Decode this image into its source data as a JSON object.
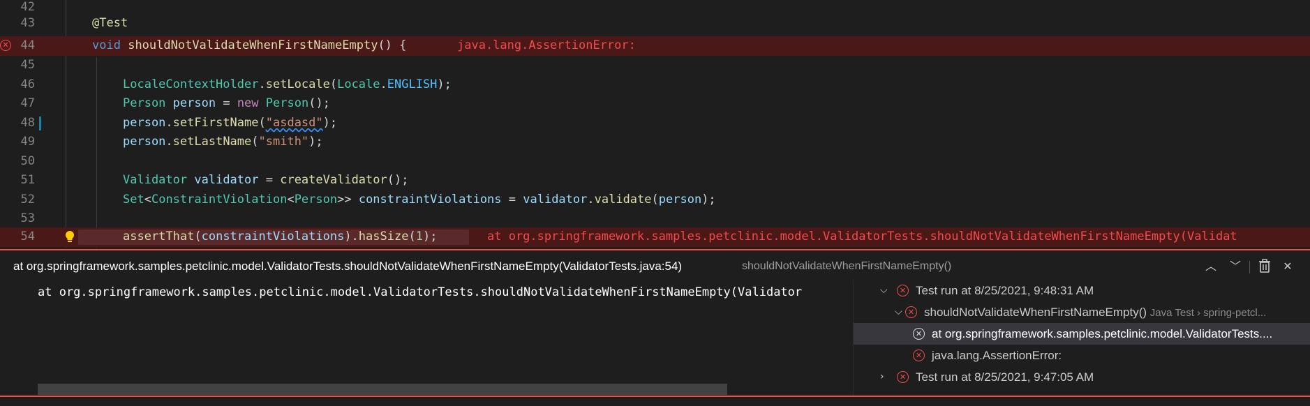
{
  "editor": {
    "lines": [
      {
        "num": "42"
      },
      {
        "num": "43",
        "annotation": "@Test"
      },
      {
        "num": "44",
        "kw": "void",
        "method": "shouldNotValidateWhenFirstNameEmpty",
        "rest": "() {",
        "inline_error": "java.lang.AssertionError:"
      },
      {
        "num": "45"
      },
      {
        "num": "46",
        "t1": "LocaleContextHolder",
        "m1": "setLocale",
        "t2": "Locale",
        "c1": "ENGLISH"
      },
      {
        "num": "47",
        "t1": "Person",
        "v1": "person",
        "kw": "new",
        "t2": "Person"
      },
      {
        "num": "48",
        "v1": "person",
        "m1": "setFirstName",
        "s1": "\"asdasd\""
      },
      {
        "num": "49",
        "v1": "person",
        "m1": "setLastName",
        "s1": "\"smith\""
      },
      {
        "num": "50"
      },
      {
        "num": "51",
        "t1": "Validator",
        "v1": "validator",
        "m1": "createValidator"
      },
      {
        "num": "52",
        "t1": "Set",
        "t2": "ConstraintViolation",
        "t3": "Person",
        "v1": "constraintViolations",
        "v2": "validator",
        "m1": "validate",
        "v3": "person"
      },
      {
        "num": "53"
      },
      {
        "num": "54",
        "m1": "assertThat",
        "v1": "constraintViolations",
        "m2": "hasSize",
        "n1": "1",
        "inline_error": "at org.springframework.samples.petclinic.model.ValidatorTests.shouldNotValidateWhenFirstNameEmpty(Validat"
      }
    ]
  },
  "peek": {
    "title": "at org.springframework.samples.petclinic.model.ValidatorTests.shouldNotValidateWhenFirstNameEmpty(ValidatorTests.java:54)",
    "subtitle": "shouldNotValidateWhenFirstNameEmpty()",
    "stack_text": "at org.springframework.samples.petclinic.model.ValidatorTests.shouldNotValidateWhenFirstNameEmpty(Validator",
    "icons": {
      "up": "chevron-up-icon",
      "down": "chevron-down-icon",
      "clear": "trash-icon",
      "close": "close-icon"
    },
    "tree": [
      {
        "label": "Test run at 8/25/2021, 9:48:31 AM",
        "expanded": true,
        "status": "failed"
      },
      {
        "label": "shouldNotValidateWhenFirstNameEmpty()",
        "description": "Java Test › spring-petcl...",
        "expanded": true,
        "status": "failed"
      },
      {
        "label": "at org.springframework.samples.petclinic.model.ValidatorTests....",
        "selected": true,
        "status": "failed"
      },
      {
        "label": "java.lang.AssertionError:",
        "status": "failed"
      },
      {
        "label": "Test run at 8/25/2021, 9:47:05 AM",
        "expanded": false,
        "status": "failed"
      }
    ]
  },
  "colors": {
    "error": "#f14c4c",
    "error_line_bg": "#4b1818",
    "editor_bg": "#1e1e1e"
  }
}
